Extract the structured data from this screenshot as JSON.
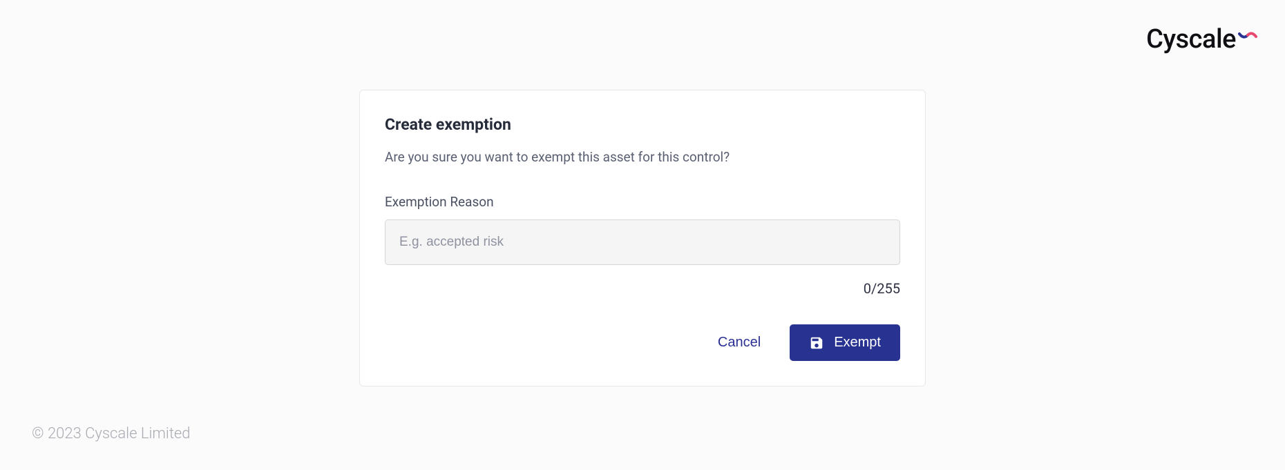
{
  "brand": {
    "name": "Cyscale"
  },
  "modal": {
    "title": "Create exemption",
    "description": "Are you sure you want to exempt this asset for this control?",
    "field_label": "Exemption Reason",
    "field_placeholder": "E.g. accepted risk",
    "field_value": "",
    "char_count": "0/255",
    "cancel_label": "Cancel",
    "submit_label": "Exempt"
  },
  "footer": {
    "copyright": "© 2023 Cyscale Limited"
  }
}
